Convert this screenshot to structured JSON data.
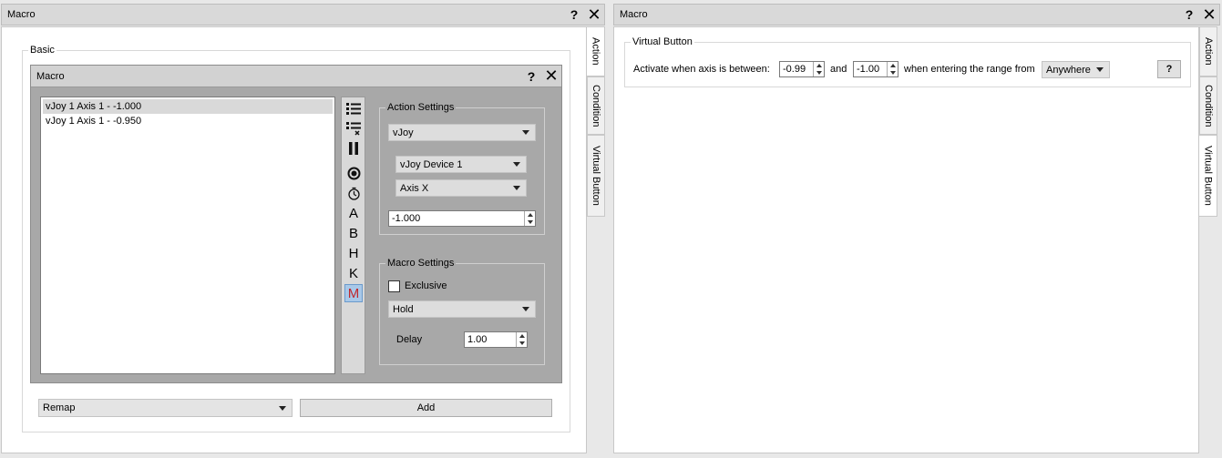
{
  "left_window": {
    "title": "Macro",
    "help_label": "?",
    "close_label": "✕",
    "tabs": [
      "Action",
      "Condition",
      "Virtual Button"
    ],
    "basic_group": "Basic",
    "inner_window": {
      "title": "Macro",
      "help_label": "?",
      "close_label": "✕",
      "list_items": [
        "vJoy 1 Axis 1 - -1.000",
        "vJoy 1 Axis 1 - -0.950"
      ],
      "toolbar_letters": [
        "A",
        "B",
        "H",
        "K",
        "M"
      ],
      "action_settings": {
        "title": "Action Settings",
        "type_value": "vJoy",
        "device_value": "vJoy Device 1",
        "axis_value": "Axis X",
        "value": "-1.000"
      },
      "macro_settings": {
        "title": "Macro Settings",
        "exclusive_label": "Exclusive",
        "mode_value": "Hold",
        "delay_label": "Delay",
        "delay_value": "1.00"
      }
    },
    "action_type_value": "Remap",
    "add_label": "Add"
  },
  "right_window": {
    "title": "Macro",
    "help_label": "?",
    "close_label": "✕",
    "tabs": [
      "Action",
      "Condition",
      "Virtual Button"
    ],
    "virtual_button": {
      "group_title": "Virtual Button",
      "activate_label": "Activate when axis is between:",
      "lower_value": "-0.99",
      "and_label": "and",
      "upper_value": "-1.00",
      "entering_label": "when entering the range from",
      "direction_value": "Anywhere",
      "help_label": "?"
    }
  }
}
